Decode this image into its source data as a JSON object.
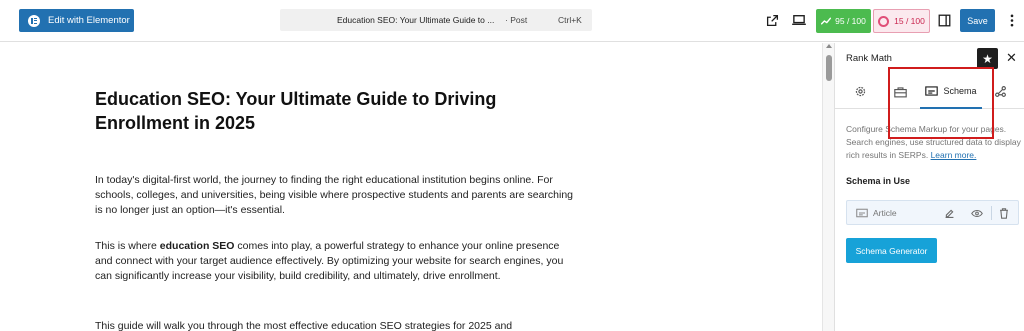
{
  "toolbar": {
    "elementor_label": "Edit with Elementor",
    "command_title": "Education SEO: Your Ultimate Guide to ...",
    "command_type": "· Post",
    "command_shortcut": "Ctrl+K",
    "seo_score": "95 / 100",
    "readability_score": "15 / 100",
    "save_label": "Save"
  },
  "editor": {
    "title": "Education SEO: Your Ultimate Guide to Driving Enrollment in 2025",
    "para1": "In today's digital-first world, the journey to finding the right educational institution begins online. For schools, colleges, and universities, being visible where prospective students and parents are searching is no longer just an option—it's essential.",
    "para2_prefix": "This is where ",
    "para2_bold": "education SEO",
    "para2_suffix": " comes into play, a powerful strategy to enhance your online presence and connect with your target audience effectively. By optimizing your website for search engines, you can significantly increase your visibility, build credibility, and ultimately, drive enrollment.",
    "para3": "This guide will walk you through the most effective education SEO strategies for 2025 and"
  },
  "sidebar": {
    "title": "Rank Math",
    "tab_schema_label": "Schema",
    "description": "Configure Schema Markup for your pages. Search engines, use structured data to display rich results in SERPs. ",
    "learn_more": "Learn more.",
    "schema_in_use_label": "Schema in Use",
    "schema_item_name": "Article",
    "generator_label": "Schema Generator"
  },
  "icons": {
    "external": "external-link-icon",
    "preview": "desktop-preview-icon",
    "settings": "sidebar-toggle-icon",
    "more": "more-vertical-icon",
    "star": "star-icon",
    "close": "close-icon",
    "gear": "gear-icon",
    "toolbox": "toolbox-icon",
    "schema": "schema-icon",
    "social": "share-icon",
    "edit": "pencil-icon",
    "view": "eye-icon",
    "delete": "trash-icon"
  },
  "colors": {
    "primary": "#2271b1",
    "seo_good": "#4cbb4f",
    "readability_bad": "#c9254f",
    "generator": "#17a2d8",
    "highlight": "#d01c1c"
  }
}
